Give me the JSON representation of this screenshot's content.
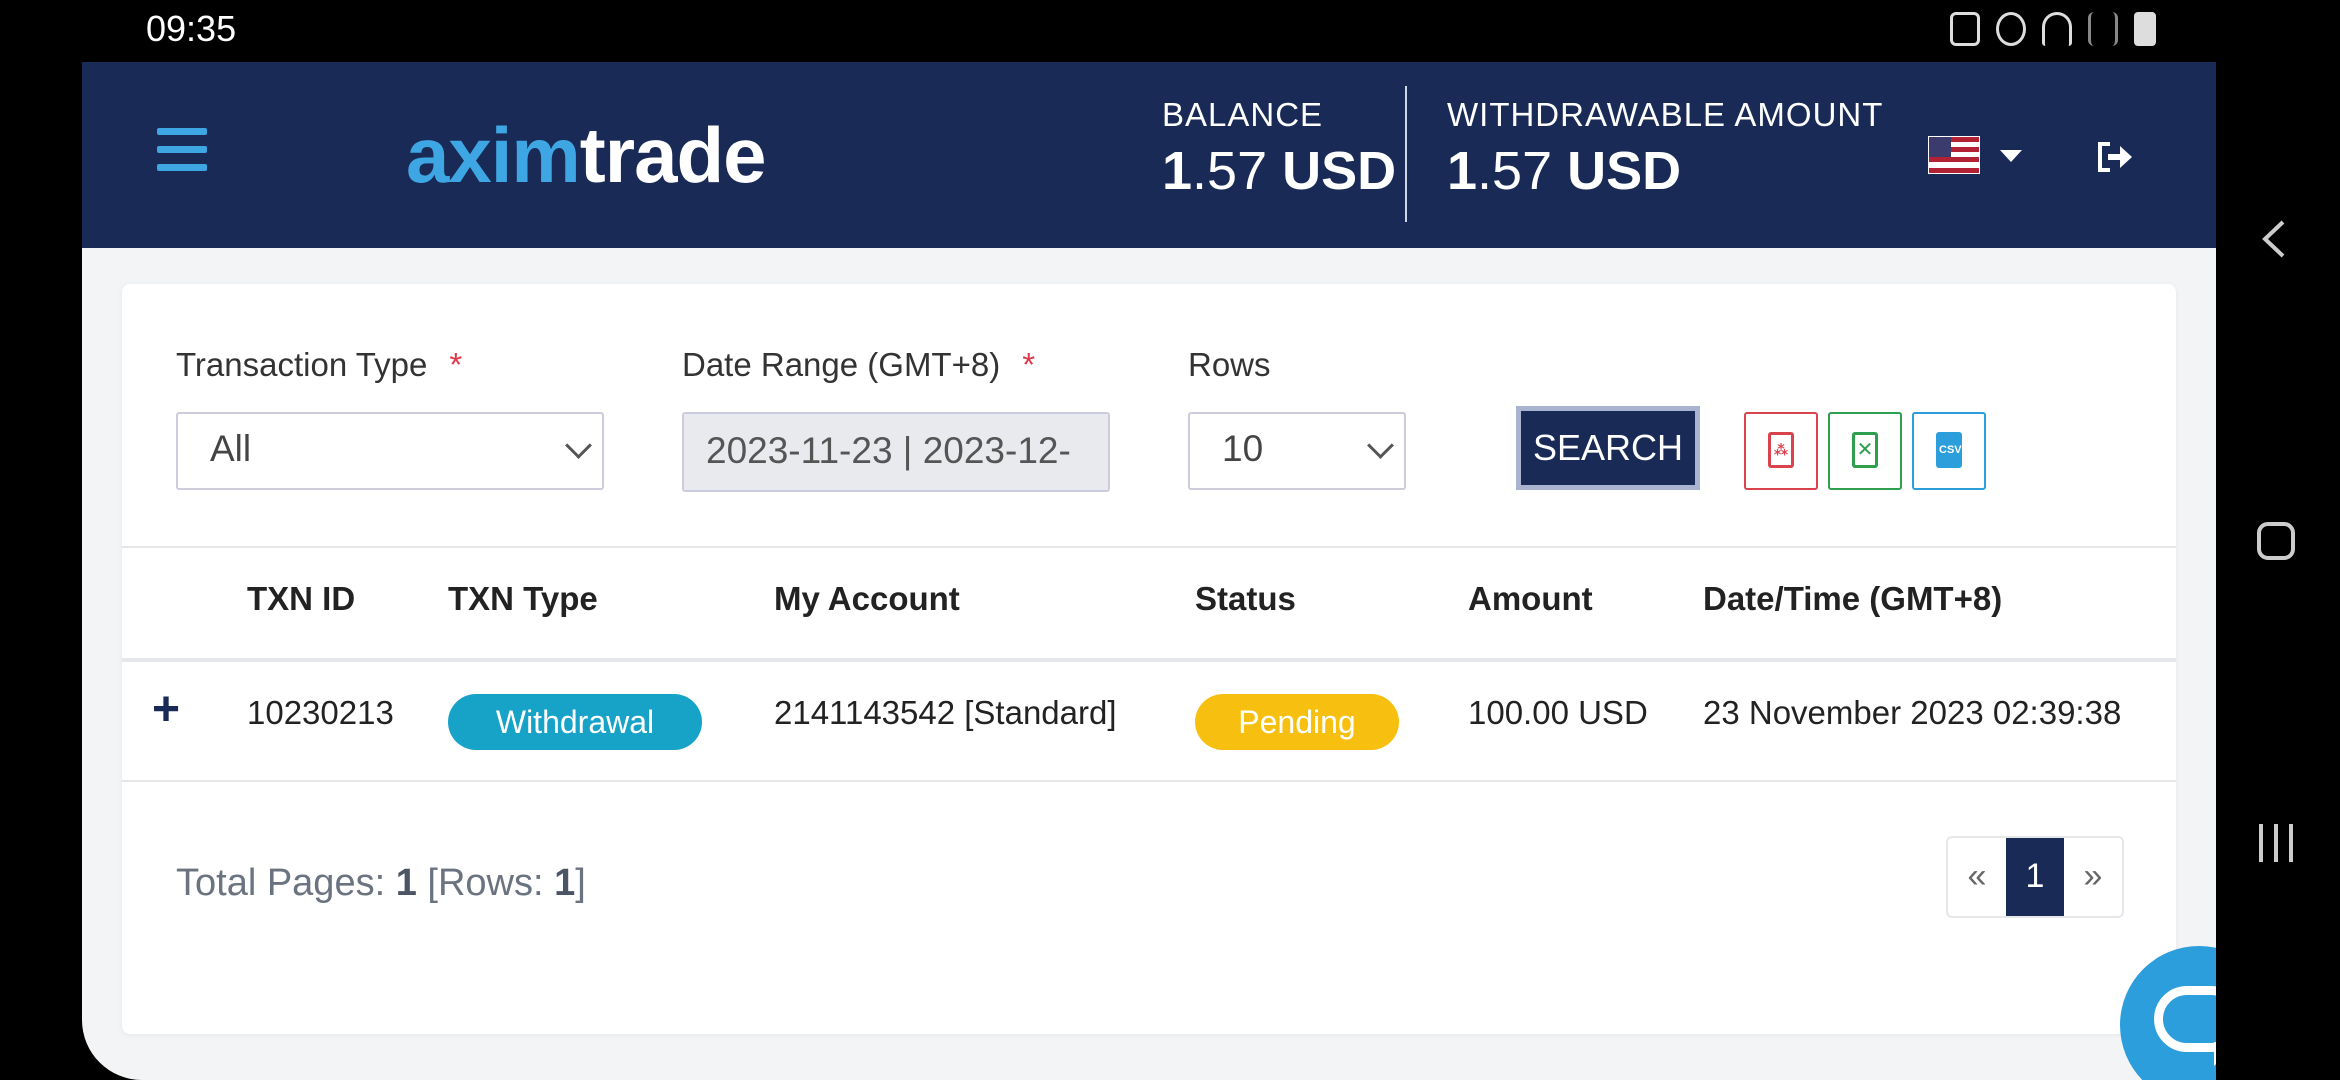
{
  "status_bar": {
    "time": "09:35"
  },
  "header": {
    "logo_part1": "axim",
    "logo_part2": "trade",
    "balance_label": "BALANCE",
    "balance_int": "1",
    "balance_dec": ".57",
    "balance_currency": "USD",
    "withdrawable_label": "WITHDRAWABLE AMOUNT",
    "withdrawable_int": "1",
    "withdrawable_dec": ".57",
    "withdrawable_currency": "USD"
  },
  "filters": {
    "transaction_type_label": "Transaction Type",
    "transaction_type_value": "All",
    "date_range_label": "Date Range (GMT+8)",
    "date_range_value": "2023-11-23 | 2023-12-",
    "rows_label": "Rows",
    "rows_value": "10",
    "required_mark": "*",
    "search_label": "SEARCH",
    "csv_label": "CSV"
  },
  "table": {
    "headers": [
      "TXN ID",
      "TXN Type",
      "My Account",
      "Status",
      "Amount",
      "Date/Time (GMT+8)"
    ],
    "rows": [
      {
        "expand": "+",
        "txn_id": "10230213",
        "txn_type": "Withdrawal",
        "account": "2141143542 [Standard]",
        "status": "Pending",
        "amount": "100.00 USD",
        "datetime": "23 November 2023 02:39:38"
      }
    ]
  },
  "pagination": {
    "total_pages_label": "Total Pages:",
    "total_pages": "1",
    "rows_label": "Rows:",
    "rows_count": "1",
    "prev": "«",
    "current": "1",
    "next": "»"
  },
  "colors": {
    "header_bg": "#192a56",
    "accent_blue": "#3ea6e3",
    "withdrawal_badge": "#17a2c8",
    "pending_badge": "#f7c010",
    "pdf_red": "#d9434e",
    "excel_green": "#2e9e4f",
    "csv_blue": "#2b9edb"
  },
  "icons": [
    "menu-icon",
    "us-flag-icon",
    "chevron-down-icon",
    "logout-icon",
    "pdf-icon",
    "excel-icon",
    "csv-icon",
    "plus-icon",
    "chat-icon",
    "back-icon",
    "home-icon",
    "recents-icon"
  ]
}
